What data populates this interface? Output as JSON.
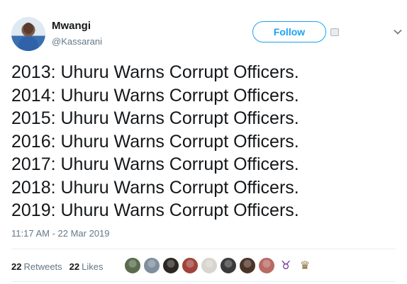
{
  "user": {
    "name": "Mwangi",
    "handle": "@Kassarani"
  },
  "actions": {
    "follow_label": "Follow"
  },
  "tweet": {
    "lines": [
      "2013: Uhuru Warns Corrupt Officers.",
      "2014: Uhuru Warns Corrupt Officers.",
      "2015: Uhuru Warns Corrupt Officers.",
      "2016: Uhuru Warns Corrupt Officers.",
      "2017: Uhuru Warns Corrupt Officers.",
      "2018: Uhuru Warns Corrupt Officers.",
      "2019: Uhuru Warns Corrupt Officers."
    ],
    "timestamp": "11:17 AM - 22 Mar 2019"
  },
  "stats": {
    "retweets_count": "22",
    "retweets_label": "Retweets",
    "likes_count": "22",
    "likes_label": "Likes"
  },
  "liker_avatars": [
    {
      "name": "liker-avatar-1",
      "color": "#5a6b4e"
    },
    {
      "name": "liker-avatar-2",
      "color": "#7f8e9c"
    },
    {
      "name": "liker-avatar-3",
      "color": "#2b2623"
    },
    {
      "name": "liker-avatar-4",
      "color": "#a0433b"
    },
    {
      "name": "liker-avatar-5",
      "color": "#d8d4cf"
    },
    {
      "name": "liker-avatar-6",
      "color": "#3a3a3a"
    },
    {
      "name": "liker-avatar-7",
      "color": "#4b3327"
    },
    {
      "name": "liker-avatar-8",
      "color": "#b86a63"
    }
  ],
  "liker_emoji_avatars": [
    {
      "name": "bull-icon",
      "glyph": "♉"
    },
    {
      "name": "trophy-icon",
      "glyph": "♛"
    }
  ],
  "colors": {
    "accent": "#1da1f2",
    "muted": "#657786",
    "text": "#14171a"
  }
}
